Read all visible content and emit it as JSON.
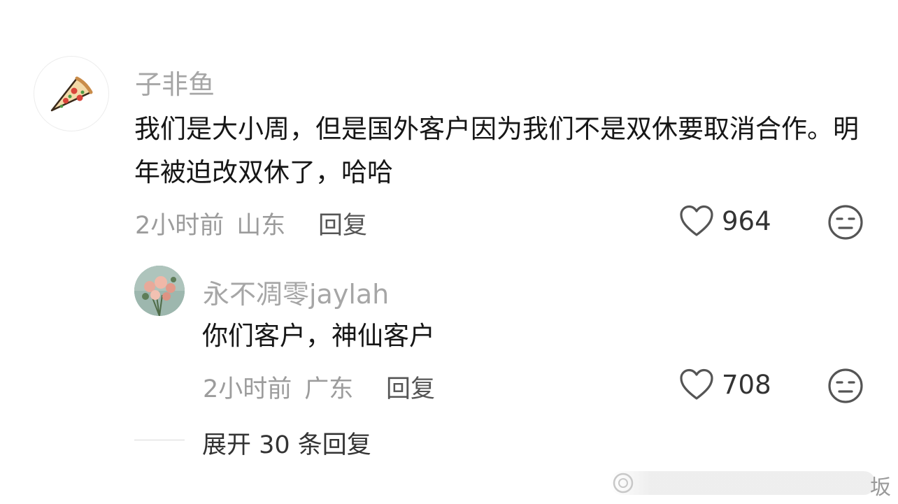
{
  "comment": {
    "username": "子非鱼",
    "text": "我们是大小周，但是国外客户因为我们不是双休要取消合作。明年被迫改双休了，哈哈",
    "time": "2小时前",
    "location": "山东",
    "reply_label": "回复",
    "likes": "964",
    "avatar_icon": "pizza-slice-icon"
  },
  "reply": {
    "username": "永不凋零jaylah",
    "text": "你们客户，神仙客户",
    "time": "2小时前",
    "location": "广东",
    "reply_label": "回复",
    "likes": "708",
    "avatar_icon": "flower-bouquet-avatar"
  },
  "expand": {
    "label": "展开 30 条回复"
  },
  "watermark": {
    "text": "坂"
  },
  "colors": {
    "username": "#a6a6a6",
    "meta": "#9c9c9c",
    "text": "#161616",
    "icon": "#555555"
  }
}
